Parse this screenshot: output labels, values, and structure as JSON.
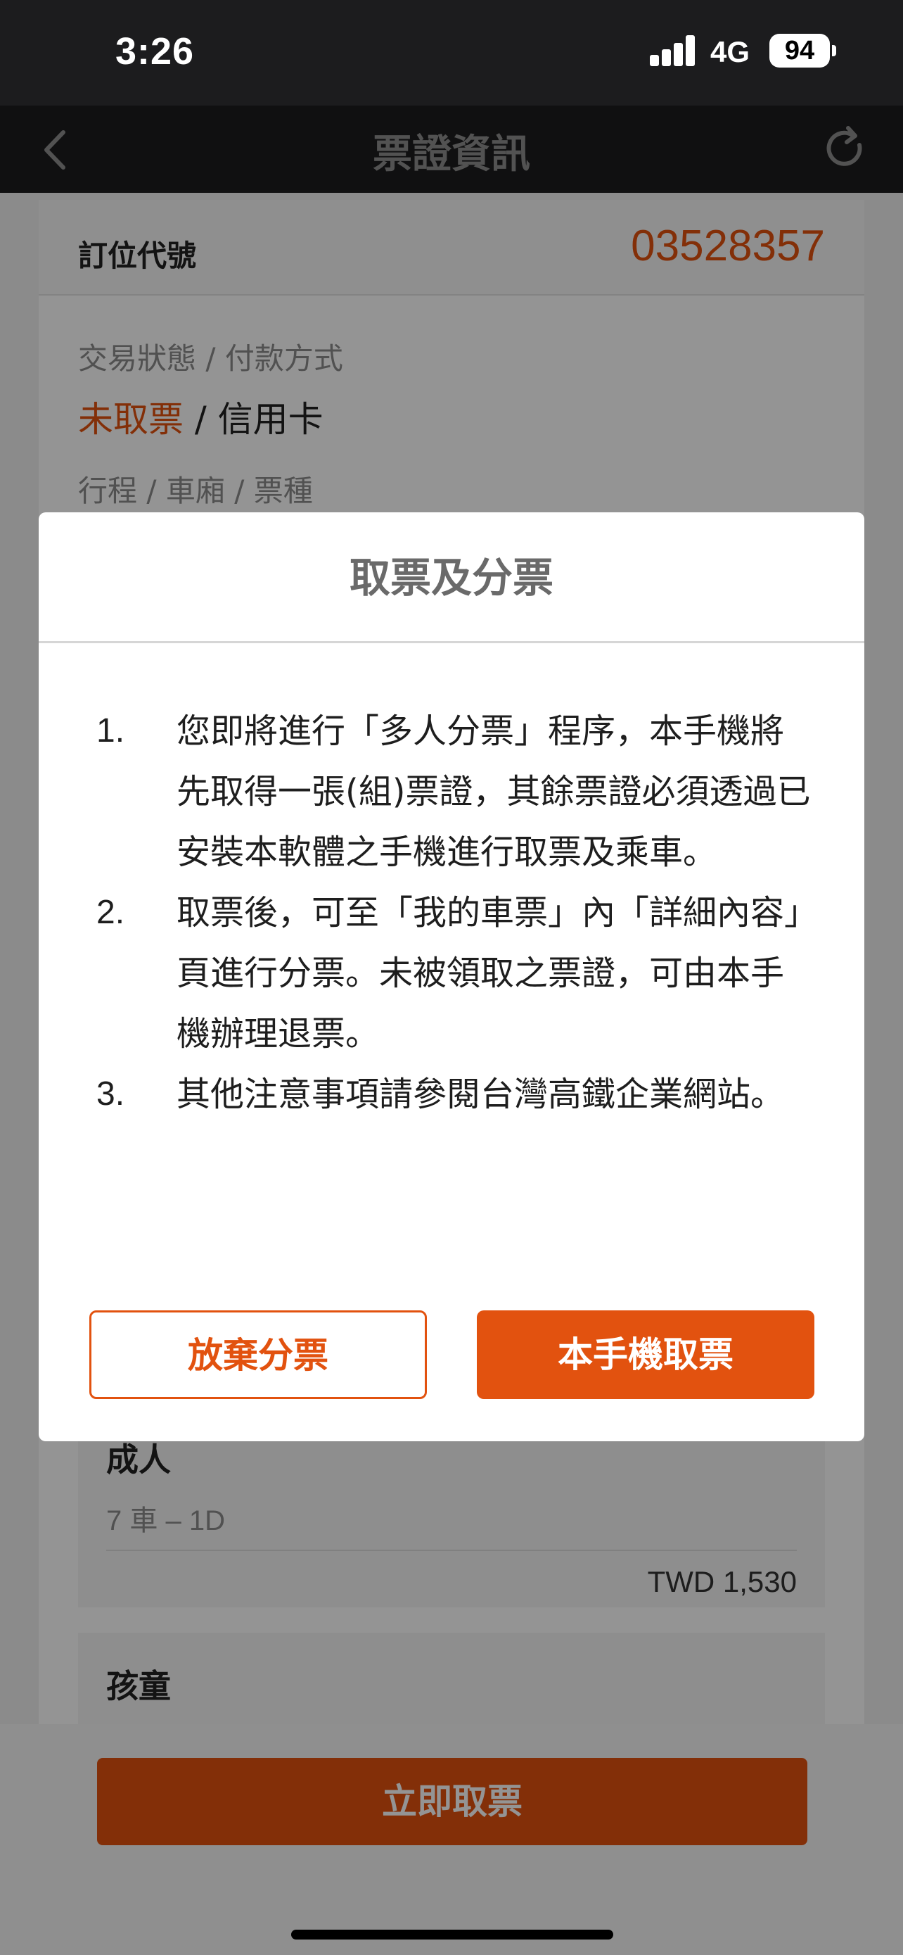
{
  "status_bar": {
    "time": "3:26",
    "network": "4G",
    "battery": "94"
  },
  "nav": {
    "title": "票證資訊"
  },
  "booking": {
    "label": "訂位代號",
    "code": "03528357"
  },
  "transaction": {
    "label": "交易狀態 / 付款方式",
    "status": "未取票",
    "separator": " / ",
    "payment": "信用卡"
  },
  "itinerary": {
    "label": "行程 / 車廂 / 票種"
  },
  "passengers": [
    {
      "type": "成人",
      "seat": "7 車 – 1D",
      "price": "TWD 1,530"
    },
    {
      "type": "孩童"
    }
  ],
  "bottom": {
    "cta_label": "立即取票"
  },
  "modal": {
    "title": "取票及分票",
    "items": [
      {
        "num": "1.",
        "text": "您即將進行「多人分票」程序，本手機將先取得一張(組)票證，其餘票證必須透過已安裝本軟體之手機進行取票及乘車。"
      },
      {
        "num": "2.",
        "text": "取票後，可至「我的車票」內「詳細內容」頁進行分票。未被領取之票證，可由本手機辦理退票。"
      },
      {
        "num": "3.",
        "text": "其他注意事項請參閱台灣高鐵企業網站。"
      }
    ],
    "secondary_label": "放棄分票",
    "primary_label": "本手機取票"
  },
  "colors": {
    "accent": "#e2520f",
    "nav_bg": "#1c1c1e"
  }
}
